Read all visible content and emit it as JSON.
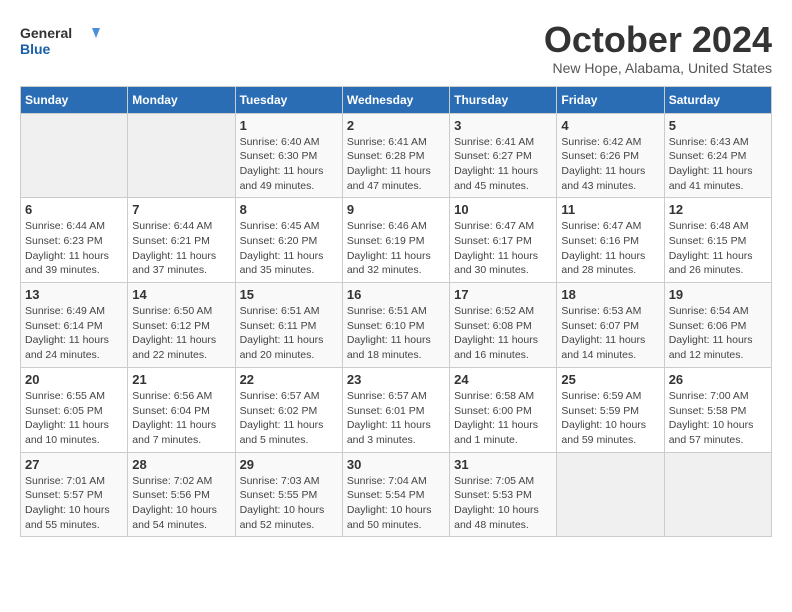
{
  "header": {
    "logo_line1": "General",
    "logo_line2": "Blue",
    "title": "October 2024",
    "subtitle": "New Hope, Alabama, United States"
  },
  "weekdays": [
    "Sunday",
    "Monday",
    "Tuesday",
    "Wednesday",
    "Thursday",
    "Friday",
    "Saturday"
  ],
  "weeks": [
    [
      {
        "day": "",
        "info": ""
      },
      {
        "day": "",
        "info": ""
      },
      {
        "day": "1",
        "info": "Sunrise: 6:40 AM\nSunset: 6:30 PM\nDaylight: 11 hours and 49 minutes."
      },
      {
        "day": "2",
        "info": "Sunrise: 6:41 AM\nSunset: 6:28 PM\nDaylight: 11 hours and 47 minutes."
      },
      {
        "day": "3",
        "info": "Sunrise: 6:41 AM\nSunset: 6:27 PM\nDaylight: 11 hours and 45 minutes."
      },
      {
        "day": "4",
        "info": "Sunrise: 6:42 AM\nSunset: 6:26 PM\nDaylight: 11 hours and 43 minutes."
      },
      {
        "day": "5",
        "info": "Sunrise: 6:43 AM\nSunset: 6:24 PM\nDaylight: 11 hours and 41 minutes."
      }
    ],
    [
      {
        "day": "6",
        "info": "Sunrise: 6:44 AM\nSunset: 6:23 PM\nDaylight: 11 hours and 39 minutes."
      },
      {
        "day": "7",
        "info": "Sunrise: 6:44 AM\nSunset: 6:21 PM\nDaylight: 11 hours and 37 minutes."
      },
      {
        "day": "8",
        "info": "Sunrise: 6:45 AM\nSunset: 6:20 PM\nDaylight: 11 hours and 35 minutes."
      },
      {
        "day": "9",
        "info": "Sunrise: 6:46 AM\nSunset: 6:19 PM\nDaylight: 11 hours and 32 minutes."
      },
      {
        "day": "10",
        "info": "Sunrise: 6:47 AM\nSunset: 6:17 PM\nDaylight: 11 hours and 30 minutes."
      },
      {
        "day": "11",
        "info": "Sunrise: 6:47 AM\nSunset: 6:16 PM\nDaylight: 11 hours and 28 minutes."
      },
      {
        "day": "12",
        "info": "Sunrise: 6:48 AM\nSunset: 6:15 PM\nDaylight: 11 hours and 26 minutes."
      }
    ],
    [
      {
        "day": "13",
        "info": "Sunrise: 6:49 AM\nSunset: 6:14 PM\nDaylight: 11 hours and 24 minutes."
      },
      {
        "day": "14",
        "info": "Sunrise: 6:50 AM\nSunset: 6:12 PM\nDaylight: 11 hours and 22 minutes."
      },
      {
        "day": "15",
        "info": "Sunrise: 6:51 AM\nSunset: 6:11 PM\nDaylight: 11 hours and 20 minutes."
      },
      {
        "day": "16",
        "info": "Sunrise: 6:51 AM\nSunset: 6:10 PM\nDaylight: 11 hours and 18 minutes."
      },
      {
        "day": "17",
        "info": "Sunrise: 6:52 AM\nSunset: 6:08 PM\nDaylight: 11 hours and 16 minutes."
      },
      {
        "day": "18",
        "info": "Sunrise: 6:53 AM\nSunset: 6:07 PM\nDaylight: 11 hours and 14 minutes."
      },
      {
        "day": "19",
        "info": "Sunrise: 6:54 AM\nSunset: 6:06 PM\nDaylight: 11 hours and 12 minutes."
      }
    ],
    [
      {
        "day": "20",
        "info": "Sunrise: 6:55 AM\nSunset: 6:05 PM\nDaylight: 11 hours and 10 minutes."
      },
      {
        "day": "21",
        "info": "Sunrise: 6:56 AM\nSunset: 6:04 PM\nDaylight: 11 hours and 7 minutes."
      },
      {
        "day": "22",
        "info": "Sunrise: 6:57 AM\nSunset: 6:02 PM\nDaylight: 11 hours and 5 minutes."
      },
      {
        "day": "23",
        "info": "Sunrise: 6:57 AM\nSunset: 6:01 PM\nDaylight: 11 hours and 3 minutes."
      },
      {
        "day": "24",
        "info": "Sunrise: 6:58 AM\nSunset: 6:00 PM\nDaylight: 11 hours and 1 minute."
      },
      {
        "day": "25",
        "info": "Sunrise: 6:59 AM\nSunset: 5:59 PM\nDaylight: 10 hours and 59 minutes."
      },
      {
        "day": "26",
        "info": "Sunrise: 7:00 AM\nSunset: 5:58 PM\nDaylight: 10 hours and 57 minutes."
      }
    ],
    [
      {
        "day": "27",
        "info": "Sunrise: 7:01 AM\nSunset: 5:57 PM\nDaylight: 10 hours and 55 minutes."
      },
      {
        "day": "28",
        "info": "Sunrise: 7:02 AM\nSunset: 5:56 PM\nDaylight: 10 hours and 54 minutes."
      },
      {
        "day": "29",
        "info": "Sunrise: 7:03 AM\nSunset: 5:55 PM\nDaylight: 10 hours and 52 minutes."
      },
      {
        "day": "30",
        "info": "Sunrise: 7:04 AM\nSunset: 5:54 PM\nDaylight: 10 hours and 50 minutes."
      },
      {
        "day": "31",
        "info": "Sunrise: 7:05 AM\nSunset: 5:53 PM\nDaylight: 10 hours and 48 minutes."
      },
      {
        "day": "",
        "info": ""
      },
      {
        "day": "",
        "info": ""
      }
    ]
  ]
}
